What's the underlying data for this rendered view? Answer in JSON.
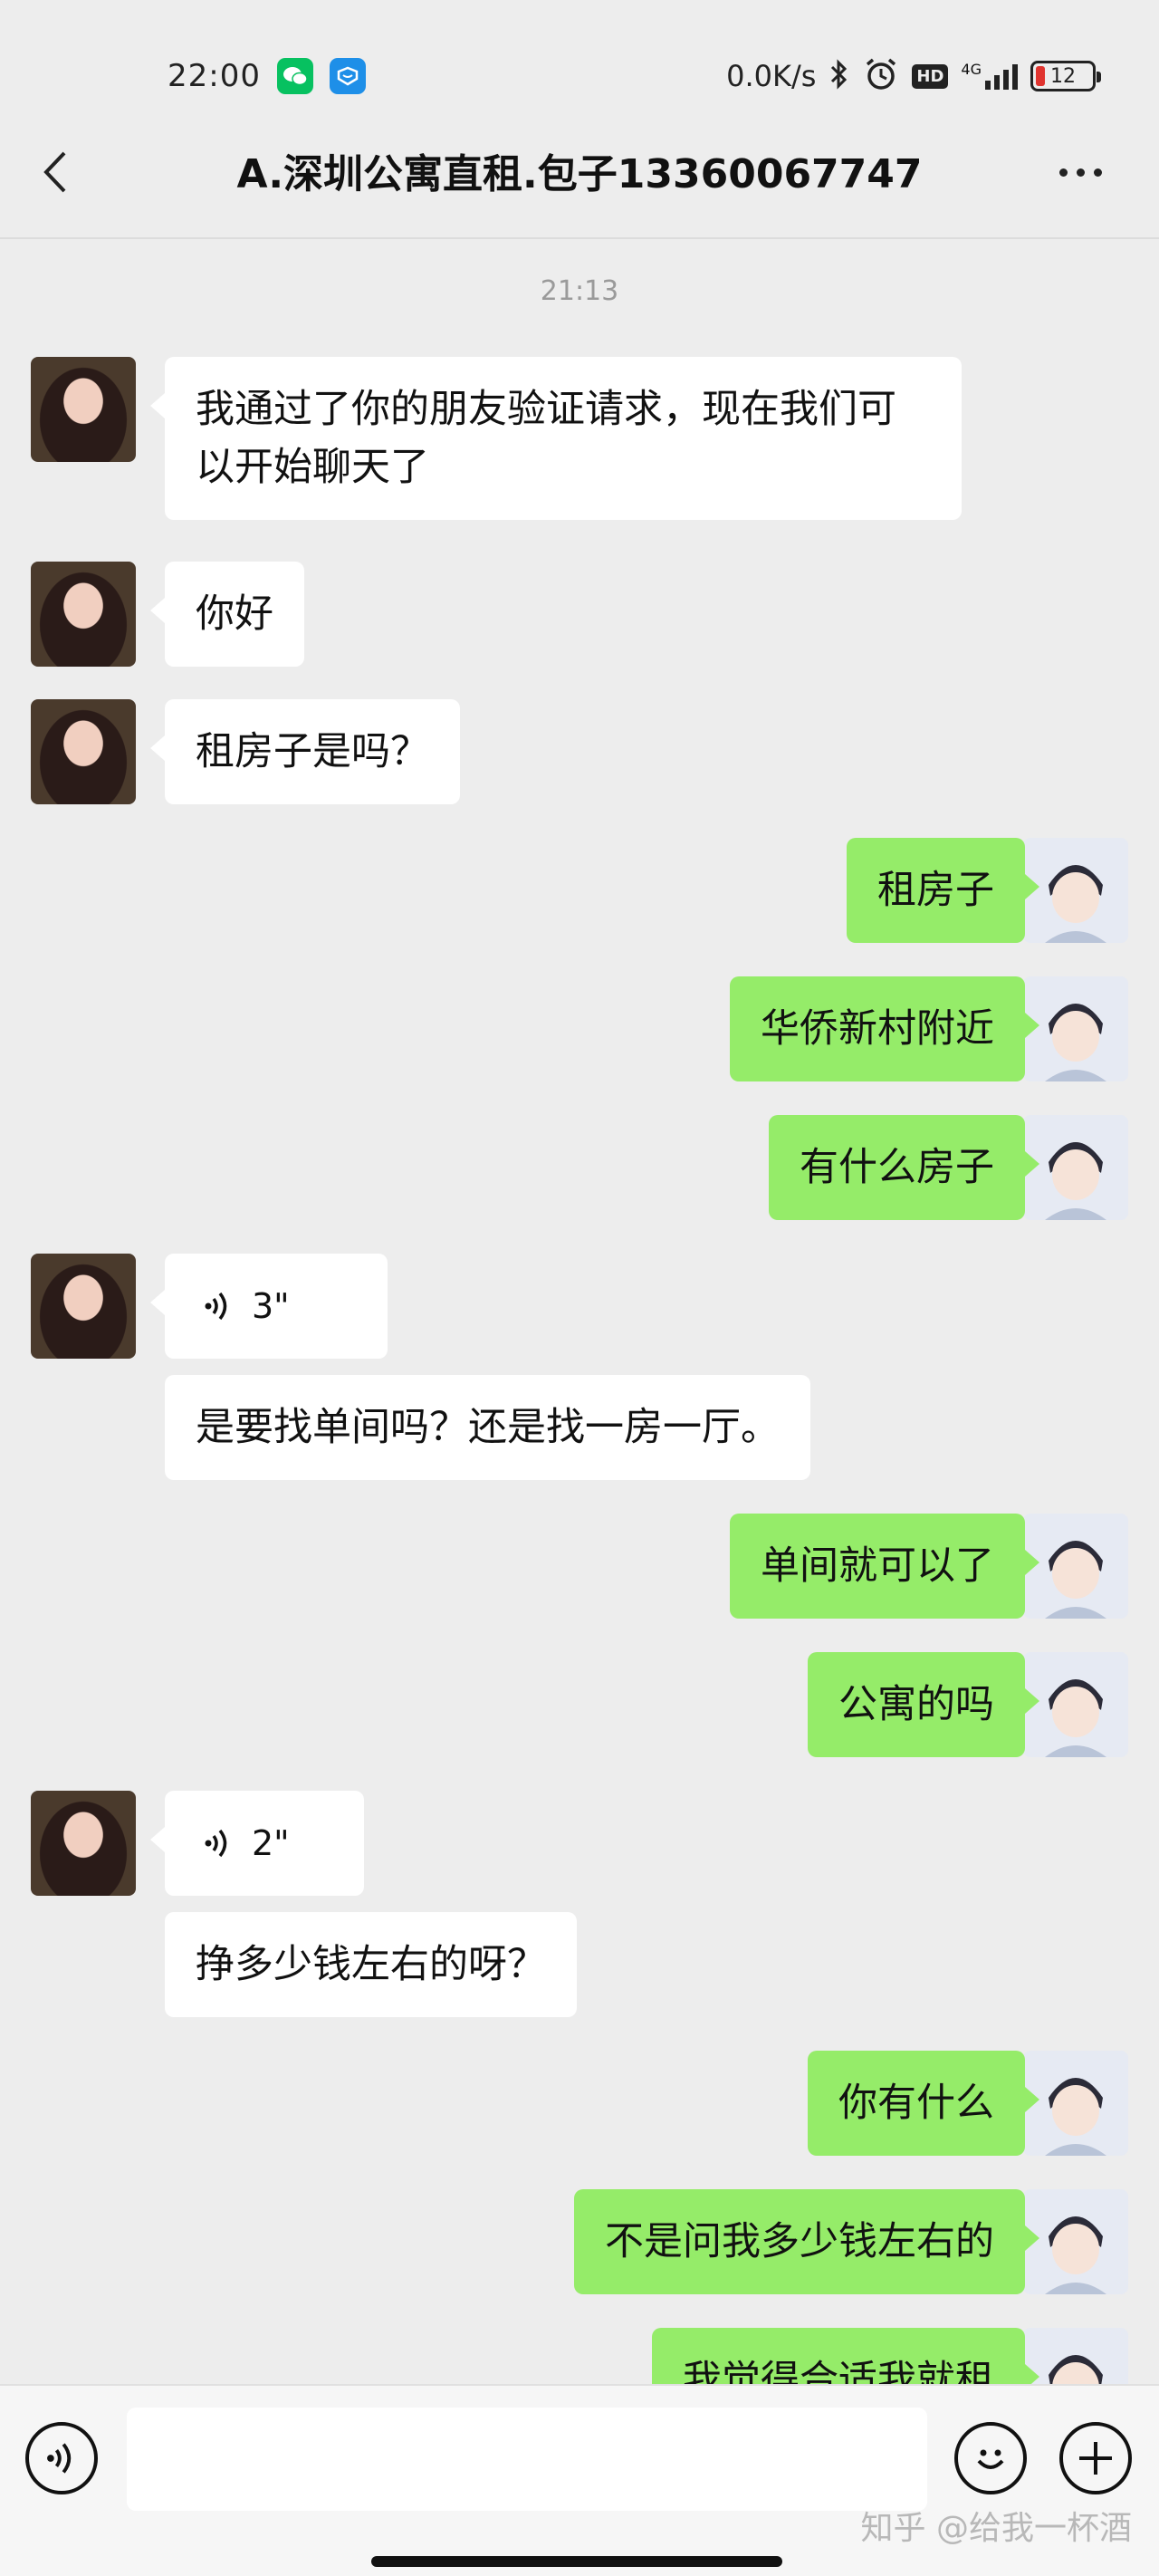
{
  "status_bar": {
    "time": "22:00",
    "net_speed": "0.0K/s",
    "network": "4G",
    "hd_label": "HD",
    "battery": "12"
  },
  "header": {
    "title": "A.深圳公寓直租.包子13360067747"
  },
  "timestamp": "21:13",
  "messages": [
    {
      "side": "left",
      "type": "text",
      "text": "我通过了你的朋友验证请求，现在我们可以开始聊天了"
    },
    {
      "side": "left",
      "type": "text",
      "text": "你好"
    },
    {
      "side": "left",
      "type": "text",
      "text": "租房子是吗？"
    },
    {
      "side": "right",
      "type": "text",
      "text": "租房子"
    },
    {
      "side": "right",
      "type": "text",
      "text": "华侨新村附近"
    },
    {
      "side": "right",
      "type": "text",
      "text": "有什么房子"
    },
    {
      "side": "left",
      "type": "voice",
      "text": "3\""
    },
    {
      "side": "left",
      "type": "text",
      "text": "是要找单间吗？还是找一房一厅。"
    },
    {
      "side": "right",
      "type": "text",
      "text": "单间就可以了"
    },
    {
      "side": "right",
      "type": "text",
      "text": "公寓的吗"
    },
    {
      "side": "left",
      "type": "voice",
      "text": "2\""
    },
    {
      "side": "left",
      "type": "text",
      "text": "挣多少钱左右的呀？"
    },
    {
      "side": "right",
      "type": "text",
      "text": "你有什么"
    },
    {
      "side": "right",
      "type": "text",
      "text": "不是问我多少钱左右的"
    },
    {
      "side": "right",
      "type": "text",
      "text": "我觉得合适我就租"
    }
  ],
  "input_bar": {
    "input_value": "",
    "watermark": "知乎 @给我一杯酒"
  },
  "colors": {
    "background": "#ededed",
    "bubble_self": "#95ec69",
    "bubble_other": "#ffffff",
    "wechat_green": "#07c160"
  },
  "icons": [
    "back-icon",
    "more-icon",
    "voice-wave-icon",
    "voice-input-icon",
    "emoji-icon",
    "add-icon",
    "bluetooth-icon",
    "alarm-icon",
    "signal-icon",
    "battery-icon"
  ]
}
